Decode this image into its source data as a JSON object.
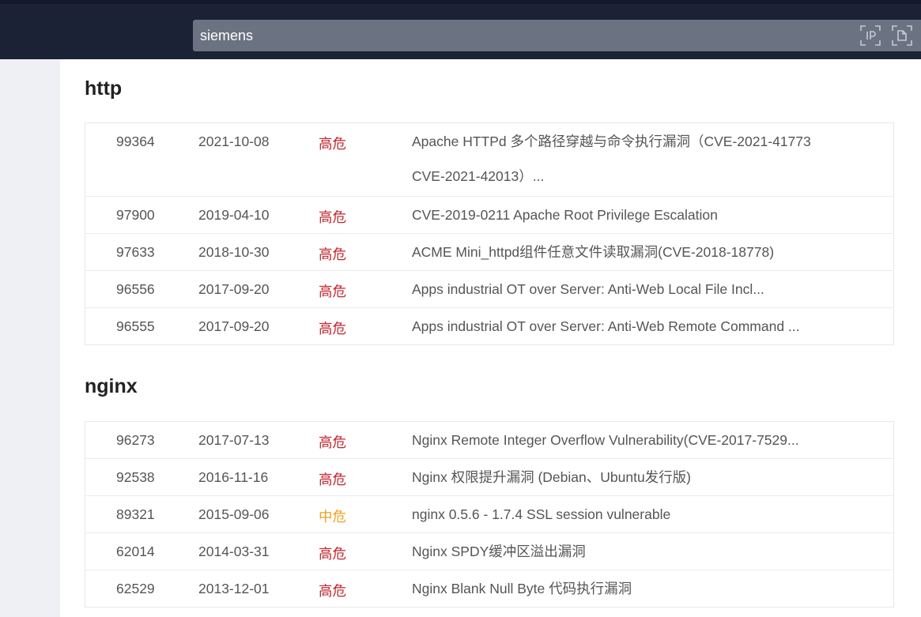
{
  "search": {
    "value": "siemens"
  },
  "search_icons": [
    "ip-scan-icon",
    "document-scan-icon"
  ],
  "colors": {
    "high": "#c0262d",
    "medium": "#f0a020",
    "header_bg": "#1c2235"
  },
  "sections": [
    {
      "title": "http",
      "rows": [
        {
          "id": "99364",
          "date": "2021-10-08",
          "level": "高危",
          "title": "Apache HTTPd 多个路径穿越与命令执行漏洞（CVE-2021-41773 CVE-2021-42013）..."
        },
        {
          "id": "97900",
          "date": "2019-04-10",
          "level": "高危",
          "title": "CVE-2019-0211 Apache Root Privilege Escalation"
        },
        {
          "id": "97633",
          "date": "2018-10-30",
          "level": "高危",
          "title": "ACME Mini_httpd组件任意文件读取漏洞(CVE-2018-18778)"
        },
        {
          "id": "96556",
          "date": "2017-09-20",
          "level": "高危",
          "title": "Apps industrial OT over Server: Anti-Web Local File Incl..."
        },
        {
          "id": "96555",
          "date": "2017-09-20",
          "level": "高危",
          "title": "Apps industrial OT over Server: Anti-Web Remote Command ..."
        }
      ]
    },
    {
      "title": "nginx",
      "rows": [
        {
          "id": "96273",
          "date": "2017-07-13",
          "level": "高危",
          "title": "Nginx Remote Integer Overflow Vulnerability(CVE-2017-7529..."
        },
        {
          "id": "92538",
          "date": "2016-11-16",
          "level": "高危",
          "title": "Nginx 权限提升漏洞 (Debian、Ubuntu发行版)"
        },
        {
          "id": "89321",
          "date": "2015-09-06",
          "level": "中危",
          "title": "nginx 0.5.6 - 1.7.4 SSL session vulnerable"
        },
        {
          "id": "62014",
          "date": "2014-03-31",
          "level": "高危",
          "title": "Nginx SPDY缓冲区溢出漏洞"
        },
        {
          "id": "62529",
          "date": "2013-12-01",
          "level": "高危",
          "title": "Nginx Blank Null Byte 代码执行漏洞"
        }
      ]
    }
  ]
}
